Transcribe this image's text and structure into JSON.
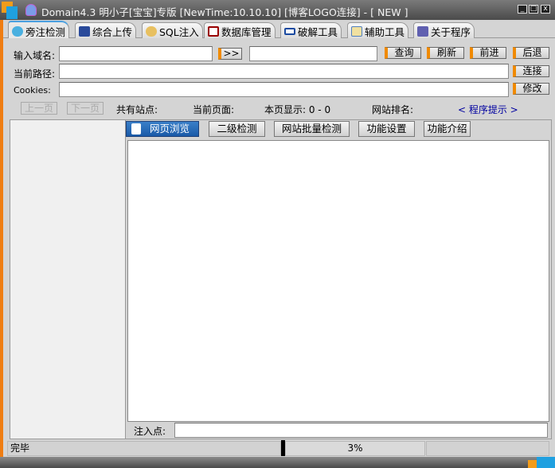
{
  "window": {
    "title": "Domain4.3 明小子[宝宝]专版 [NewTime:10.10.10] [博客LOGO连接]  - [ NEW ]",
    "controls": {
      "minimize": "_",
      "maximize": "□",
      "close": "x"
    }
  },
  "tabs": [
    {
      "label": "旁注检测",
      "icon": "magnifier-icon",
      "active": true
    },
    {
      "label": "综合上传",
      "icon": "chart-icon"
    },
    {
      "label": "SQL注入",
      "icon": "magnifier-icon"
    },
    {
      "label": "数据库管理",
      "icon": "database-icon"
    },
    {
      "label": "破解工具",
      "icon": "key-icon"
    },
    {
      "label": "辅助工具",
      "icon": "clipboard-icon"
    },
    {
      "label": "关于程序",
      "icon": "book-icon"
    }
  ],
  "form": {
    "domain_label": "输入域名:",
    "domain_value": "",
    "go_label": ">>",
    "second_value": "",
    "query": "查询",
    "refresh": "刷新",
    "forward": "前进",
    "back": "后退",
    "path_label": "当前路径:",
    "path_value": "",
    "connect": "连接",
    "cookies_label": "Cookies:",
    "cookies_value": "",
    "modify": "修改"
  },
  "pager": {
    "prev": "上一页",
    "next": "下一页",
    "total_sites": "共有站点:",
    "current_page": "当前页面:",
    "page_display": "本页显示: 0 - 0",
    "rank": "网站排名:",
    "hint": "< 程序提示 >"
  },
  "subtabs": {
    "browse": "网页浏览",
    "second": "二级检测",
    "batch": "网站批量检测",
    "settings": "功能设置",
    "intro": "功能介绍"
  },
  "inject": {
    "label": "注入点:",
    "value": ""
  },
  "status": {
    "text": "完毕",
    "progress_label": "3%",
    "progress": 3
  },
  "colors": {
    "accent": "#ef7d12",
    "hint": "#0000a0",
    "selected": "#1a5aa8"
  }
}
